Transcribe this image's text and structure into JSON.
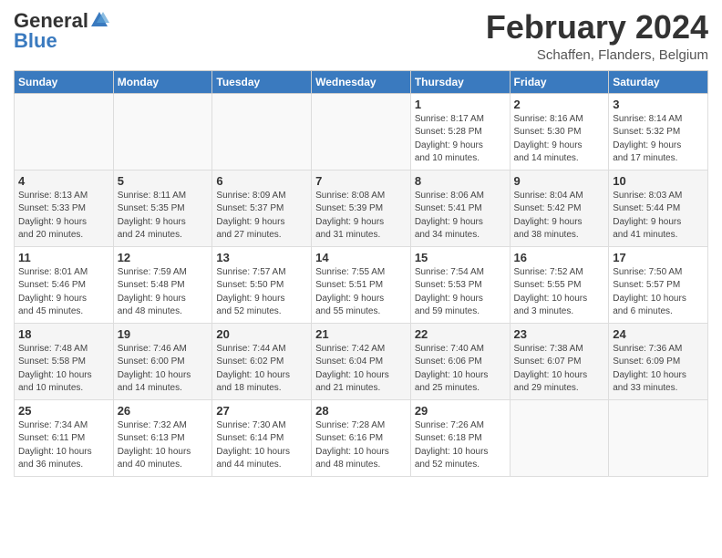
{
  "header": {
    "logo_general": "General",
    "logo_blue": "Blue",
    "month_title": "February 2024",
    "subtitle": "Schaffen, Flanders, Belgium"
  },
  "weekdays": [
    "Sunday",
    "Monday",
    "Tuesday",
    "Wednesday",
    "Thursday",
    "Friday",
    "Saturday"
  ],
  "weeks": [
    [
      {
        "day": "",
        "info": ""
      },
      {
        "day": "",
        "info": ""
      },
      {
        "day": "",
        "info": ""
      },
      {
        "day": "",
        "info": ""
      },
      {
        "day": "1",
        "info": "Sunrise: 8:17 AM\nSunset: 5:28 PM\nDaylight: 9 hours\nand 10 minutes."
      },
      {
        "day": "2",
        "info": "Sunrise: 8:16 AM\nSunset: 5:30 PM\nDaylight: 9 hours\nand 14 minutes."
      },
      {
        "day": "3",
        "info": "Sunrise: 8:14 AM\nSunset: 5:32 PM\nDaylight: 9 hours\nand 17 minutes."
      }
    ],
    [
      {
        "day": "4",
        "info": "Sunrise: 8:13 AM\nSunset: 5:33 PM\nDaylight: 9 hours\nand 20 minutes."
      },
      {
        "day": "5",
        "info": "Sunrise: 8:11 AM\nSunset: 5:35 PM\nDaylight: 9 hours\nand 24 minutes."
      },
      {
        "day": "6",
        "info": "Sunrise: 8:09 AM\nSunset: 5:37 PM\nDaylight: 9 hours\nand 27 minutes."
      },
      {
        "day": "7",
        "info": "Sunrise: 8:08 AM\nSunset: 5:39 PM\nDaylight: 9 hours\nand 31 minutes."
      },
      {
        "day": "8",
        "info": "Sunrise: 8:06 AM\nSunset: 5:41 PM\nDaylight: 9 hours\nand 34 minutes."
      },
      {
        "day": "9",
        "info": "Sunrise: 8:04 AM\nSunset: 5:42 PM\nDaylight: 9 hours\nand 38 minutes."
      },
      {
        "day": "10",
        "info": "Sunrise: 8:03 AM\nSunset: 5:44 PM\nDaylight: 9 hours\nand 41 minutes."
      }
    ],
    [
      {
        "day": "11",
        "info": "Sunrise: 8:01 AM\nSunset: 5:46 PM\nDaylight: 9 hours\nand 45 minutes."
      },
      {
        "day": "12",
        "info": "Sunrise: 7:59 AM\nSunset: 5:48 PM\nDaylight: 9 hours\nand 48 minutes."
      },
      {
        "day": "13",
        "info": "Sunrise: 7:57 AM\nSunset: 5:50 PM\nDaylight: 9 hours\nand 52 minutes."
      },
      {
        "day": "14",
        "info": "Sunrise: 7:55 AM\nSunset: 5:51 PM\nDaylight: 9 hours\nand 55 minutes."
      },
      {
        "day": "15",
        "info": "Sunrise: 7:54 AM\nSunset: 5:53 PM\nDaylight: 9 hours\nand 59 minutes."
      },
      {
        "day": "16",
        "info": "Sunrise: 7:52 AM\nSunset: 5:55 PM\nDaylight: 10 hours\nand 3 minutes."
      },
      {
        "day": "17",
        "info": "Sunrise: 7:50 AM\nSunset: 5:57 PM\nDaylight: 10 hours\nand 6 minutes."
      }
    ],
    [
      {
        "day": "18",
        "info": "Sunrise: 7:48 AM\nSunset: 5:58 PM\nDaylight: 10 hours\nand 10 minutes."
      },
      {
        "day": "19",
        "info": "Sunrise: 7:46 AM\nSunset: 6:00 PM\nDaylight: 10 hours\nand 14 minutes."
      },
      {
        "day": "20",
        "info": "Sunrise: 7:44 AM\nSunset: 6:02 PM\nDaylight: 10 hours\nand 18 minutes."
      },
      {
        "day": "21",
        "info": "Sunrise: 7:42 AM\nSunset: 6:04 PM\nDaylight: 10 hours\nand 21 minutes."
      },
      {
        "day": "22",
        "info": "Sunrise: 7:40 AM\nSunset: 6:06 PM\nDaylight: 10 hours\nand 25 minutes."
      },
      {
        "day": "23",
        "info": "Sunrise: 7:38 AM\nSunset: 6:07 PM\nDaylight: 10 hours\nand 29 minutes."
      },
      {
        "day": "24",
        "info": "Sunrise: 7:36 AM\nSunset: 6:09 PM\nDaylight: 10 hours\nand 33 minutes."
      }
    ],
    [
      {
        "day": "25",
        "info": "Sunrise: 7:34 AM\nSunset: 6:11 PM\nDaylight: 10 hours\nand 36 minutes."
      },
      {
        "day": "26",
        "info": "Sunrise: 7:32 AM\nSunset: 6:13 PM\nDaylight: 10 hours\nand 40 minutes."
      },
      {
        "day": "27",
        "info": "Sunrise: 7:30 AM\nSunset: 6:14 PM\nDaylight: 10 hours\nand 44 minutes."
      },
      {
        "day": "28",
        "info": "Sunrise: 7:28 AM\nSunset: 6:16 PM\nDaylight: 10 hours\nand 48 minutes."
      },
      {
        "day": "29",
        "info": "Sunrise: 7:26 AM\nSunset: 6:18 PM\nDaylight: 10 hours\nand 52 minutes."
      },
      {
        "day": "",
        "info": ""
      },
      {
        "day": "",
        "info": ""
      }
    ]
  ]
}
